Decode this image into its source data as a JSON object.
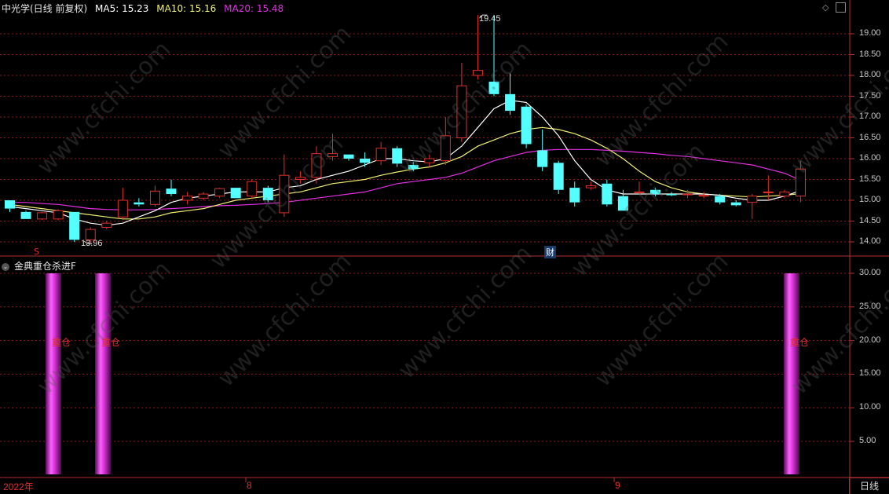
{
  "top_header": {
    "stock": "中光学(日线 前复权)",
    "ma5": "MA5: 15.23",
    "ma10": "MA10: 15.16",
    "ma20": "MA20: 15.48"
  },
  "bottom_header": {
    "indicator": "金典重仓杀进F"
  },
  "colors": {
    "up": "#e0302a",
    "down": "#54ffff",
    "ma5": "#ffffff",
    "ma10": "#f0f070",
    "ma20": "#e030e0",
    "grid": "#8b1a1a",
    "bar": "#c020c0"
  },
  "markers": {
    "high_label": "19.45",
    "low_label": "13.96",
    "cai_label": "财",
    "s_label": "S"
  },
  "price_axis": [
    "19.00",
    "18.50",
    "18.00",
    "17.50",
    "17.00",
    "16.50",
    "16.00",
    "15.50",
    "15.00",
    "14.50",
    "14.00"
  ],
  "ind_axis": [
    "30.00",
    "25.00",
    "20.00",
    "15.00",
    "10.00",
    "5.00"
  ],
  "time_axis": [
    "2022年",
    "8",
    "9"
  ],
  "timeframe": "日线",
  "watermark": "www.cfchi.com",
  "chart_data": {
    "type": "candlestick",
    "title": "中光学(日线 前复权)",
    "ylim": [
      13.8,
      19.6
    ],
    "candles": [
      {
        "o": 15.0,
        "h": 15.0,
        "l": 14.72,
        "c": 14.8
      },
      {
        "o": 14.72,
        "h": 14.75,
        "l": 14.55,
        "c": 14.55
      },
      {
        "o": 14.55,
        "h": 14.72,
        "l": 14.52,
        "c": 14.7
      },
      {
        "o": 14.55,
        "h": 14.78,
        "l": 14.52,
        "c": 14.75
      },
      {
        "o": 14.72,
        "h": 14.72,
        "l": 14.0,
        "c": 14.05
      },
      {
        "o": 14.05,
        "h": 14.35,
        "l": 13.96,
        "c": 14.3
      },
      {
        "o": 14.35,
        "h": 14.5,
        "l": 14.3,
        "c": 14.45
      },
      {
        "o": 14.6,
        "h": 15.3,
        "l": 14.55,
        "c": 15.0
      },
      {
        "o": 14.95,
        "h": 15.05,
        "l": 14.85,
        "c": 14.9
      },
      {
        "o": 14.9,
        "h": 15.35,
        "l": 14.85,
        "c": 15.22
      },
      {
        "o": 15.28,
        "h": 15.5,
        "l": 15.1,
        "c": 15.15
      },
      {
        "o": 15.0,
        "h": 15.2,
        "l": 14.9,
        "c": 15.1
      },
      {
        "o": 15.05,
        "h": 15.2,
        "l": 15.0,
        "c": 15.15
      },
      {
        "o": 15.1,
        "h": 15.3,
        "l": 15.05,
        "c": 15.28
      },
      {
        "o": 15.3,
        "h": 15.3,
        "l": 15.05,
        "c": 15.05
      },
      {
        "o": 15.1,
        "h": 15.5,
        "l": 15.05,
        "c": 15.45
      },
      {
        "o": 15.3,
        "h": 15.35,
        "l": 14.95,
        "c": 15.0
      },
      {
        "o": 14.7,
        "h": 16.1,
        "l": 14.6,
        "c": 15.6
      },
      {
        "o": 15.5,
        "h": 15.7,
        "l": 15.4,
        "c": 15.55
      },
      {
        "o": 15.55,
        "h": 16.3,
        "l": 15.4,
        "c": 16.12
      },
      {
        "o": 16.05,
        "h": 16.6,
        "l": 15.95,
        "c": 16.12
      },
      {
        "o": 16.1,
        "h": 16.1,
        "l": 15.95,
        "c": 16.0
      },
      {
        "o": 16.0,
        "h": 16.15,
        "l": 15.8,
        "c": 15.9
      },
      {
        "o": 15.95,
        "h": 16.4,
        "l": 15.85,
        "c": 16.25
      },
      {
        "o": 16.25,
        "h": 16.3,
        "l": 15.8,
        "c": 15.88
      },
      {
        "o": 15.85,
        "h": 15.92,
        "l": 15.7,
        "c": 15.75
      },
      {
        "o": 15.9,
        "h": 16.1,
        "l": 15.8,
        "c": 16.0
      },
      {
        "o": 15.95,
        "h": 17.0,
        "l": 15.85,
        "c": 16.55
      },
      {
        "o": 16.5,
        "h": 18.3,
        "l": 16.4,
        "c": 17.75
      },
      {
        "o": 18.0,
        "h": 19.45,
        "l": 17.9,
        "c": 18.12
      },
      {
        "o": 17.85,
        "h": 19.45,
        "l": 17.5,
        "c": 17.55
      },
      {
        "o": 17.55,
        "h": 18.05,
        "l": 17.05,
        "c": 17.15
      },
      {
        "o": 17.25,
        "h": 17.3,
        "l": 16.25,
        "c": 16.35
      },
      {
        "o": 16.2,
        "h": 16.7,
        "l": 15.7,
        "c": 15.8
      },
      {
        "o": 15.9,
        "h": 15.95,
        "l": 15.15,
        "c": 15.25
      },
      {
        "o": 15.3,
        "h": 15.45,
        "l": 14.85,
        "c": 14.95
      },
      {
        "o": 15.3,
        "h": 15.45,
        "l": 15.25,
        "c": 15.35
      },
      {
        "o": 15.4,
        "h": 15.5,
        "l": 14.85,
        "c": 14.9
      },
      {
        "o": 15.1,
        "h": 15.25,
        "l": 14.75,
        "c": 14.75
      },
      {
        "o": 15.2,
        "h": 15.45,
        "l": 15.15,
        "c": 15.2
      },
      {
        "o": 15.25,
        "h": 15.3,
        "l": 15.1,
        "c": 15.15
      },
      {
        "o": 15.15,
        "h": 15.2,
        "l": 15.1,
        "c": 15.12
      },
      {
        "o": 15.15,
        "h": 15.25,
        "l": 15.05,
        "c": 15.15
      },
      {
        "o": 15.1,
        "h": 15.2,
        "l": 15.05,
        "c": 15.12
      },
      {
        "o": 15.1,
        "h": 15.15,
        "l": 14.9,
        "c": 14.95
      },
      {
        "o": 14.95,
        "h": 15.0,
        "l": 14.85,
        "c": 14.88
      },
      {
        "o": 14.95,
        "h": 15.15,
        "l": 14.55,
        "c": 15.1
      },
      {
        "o": 15.2,
        "h": 15.6,
        "l": 15.0,
        "c": 15.2
      },
      {
        "o": 15.1,
        "h": 15.25,
        "l": 15.05,
        "c": 15.2
      },
      {
        "o": 15.1,
        "h": 15.95,
        "l": 14.95,
        "c": 15.75
      }
    ],
    "ma5": [
      14.85,
      14.8,
      14.75,
      14.7,
      14.55,
      14.45,
      14.4,
      14.45,
      14.6,
      14.75,
      14.95,
      15.05,
      15.1,
      15.15,
      15.2,
      15.2,
      15.2,
      15.3,
      15.35,
      15.5,
      15.6,
      15.7,
      15.85,
      16.0,
      16.0,
      15.95,
      15.92,
      16.0,
      16.3,
      16.75,
      17.2,
      17.4,
      17.35,
      17.0,
      16.55,
      15.95,
      15.5,
      15.25,
      15.15,
      15.15,
      15.15,
      15.15,
      15.15,
      15.15,
      15.12,
      15.05,
      15.0,
      15.0,
      15.1,
      15.23
    ],
    "ma10": [
      14.9,
      14.85,
      14.8,
      14.75,
      14.7,
      14.65,
      14.6,
      14.55,
      14.55,
      14.6,
      14.7,
      14.75,
      14.8,
      14.9,
      15.0,
      15.05,
      15.1,
      15.15,
      15.2,
      15.3,
      15.4,
      15.45,
      15.5,
      15.6,
      15.68,
      15.75,
      15.8,
      15.9,
      16.05,
      16.3,
      16.45,
      16.6,
      16.7,
      16.75,
      16.7,
      16.6,
      16.45,
      16.25,
      16.0,
      15.7,
      15.45,
      15.3,
      15.2,
      15.15,
      15.12,
      15.1,
      15.08,
      15.1,
      15.12,
      15.16
    ],
    "ma20": [
      14.95,
      14.95,
      14.92,
      14.9,
      14.85,
      14.8,
      14.78,
      14.77,
      14.77,
      14.78,
      14.8,
      14.82,
      14.85,
      14.87,
      14.88,
      14.9,
      14.92,
      14.95,
      15.0,
      15.05,
      15.1,
      15.15,
      15.2,
      15.3,
      15.4,
      15.45,
      15.5,
      15.55,
      15.65,
      15.8,
      15.95,
      16.05,
      16.15,
      16.2,
      16.22,
      16.22,
      16.22,
      16.2,
      16.18,
      16.15,
      16.12,
      16.08,
      16.05,
      16.0,
      15.95,
      15.9,
      15.85,
      15.75,
      15.65,
      15.48
    ],
    "signals": [
      {
        "index": 3,
        "value": 30,
        "label": "重仓"
      },
      {
        "index": 6,
        "value": 30,
        "label": "重仓"
      },
      {
        "index": 49,
        "value": 30,
        "label": "重仓"
      }
    ],
    "ind_ylim": [
      0,
      31
    ]
  }
}
